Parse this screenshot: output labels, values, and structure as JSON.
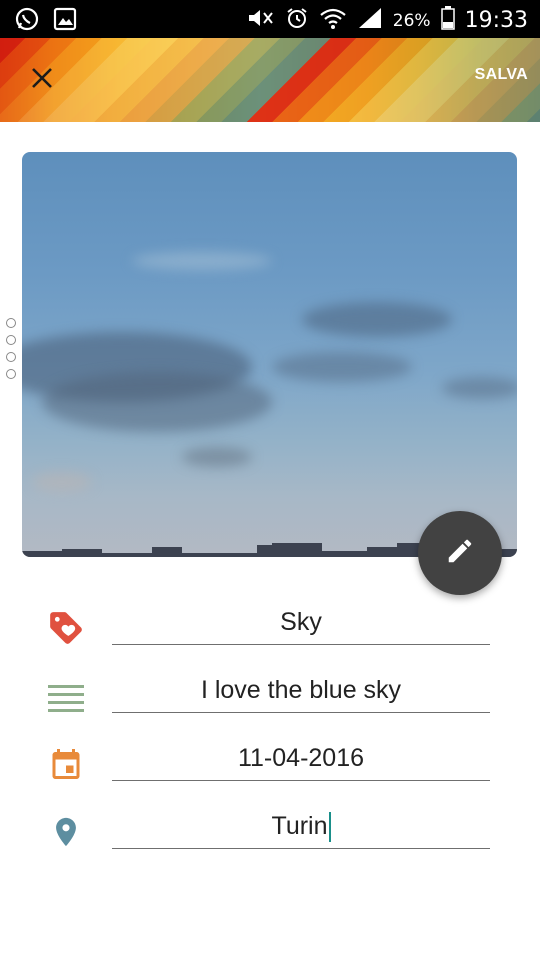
{
  "status_bar": {
    "battery_percent": "26%",
    "time": "19:33"
  },
  "toolbar": {
    "close_icon": "close-icon",
    "save_label": "SALVA"
  },
  "form": {
    "tag": {
      "icon": "tag-heart-icon",
      "value": "Sky",
      "icon_color": "#e0513f"
    },
    "description": {
      "icon": "notes-lines-icon",
      "value": "I love the blue sky",
      "icon_color": "#8fae8b"
    },
    "date": {
      "icon": "calendar-icon",
      "value": "11-04-2016",
      "icon_color": "#e88a3a"
    },
    "location": {
      "icon": "location-pin-icon",
      "value": "Turin",
      "icon_color": "#5d8ea0"
    }
  },
  "fab": {
    "icon": "edit-pencil-icon"
  }
}
